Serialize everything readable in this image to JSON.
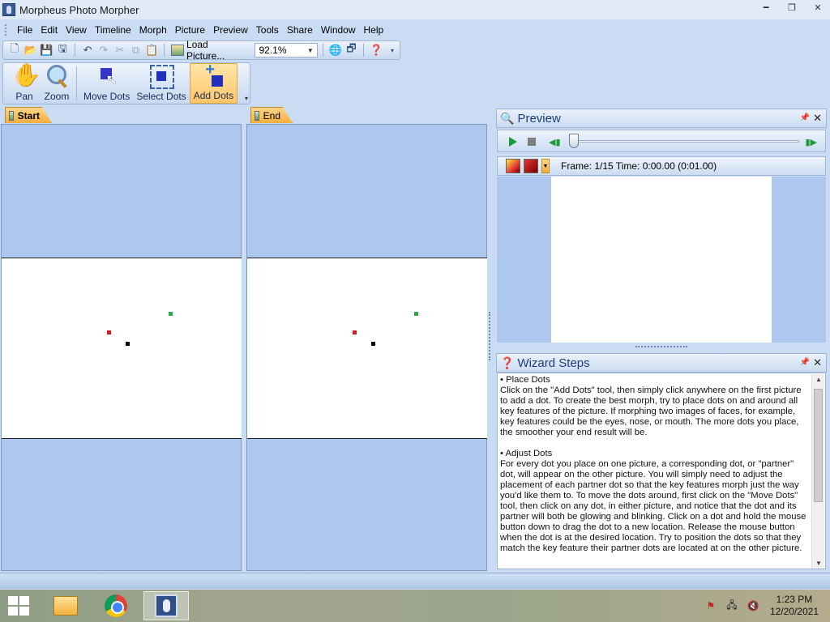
{
  "window": {
    "title": "Morpheus Photo Morpher"
  },
  "menu": [
    "File",
    "Edit",
    "View",
    "Timeline",
    "Morph",
    "Picture",
    "Preview",
    "Tools",
    "Share",
    "Window",
    "Help"
  ],
  "quickbar": {
    "load_label": "Load Picture...",
    "zoom_value": "92.1%"
  },
  "tools": {
    "pan": "Pan",
    "zoom": "Zoom",
    "move_dots": "Move Dots",
    "select_dots": "Select Dots",
    "add_dots": "Add Dots",
    "active": "add_dots"
  },
  "tabs": {
    "start": "Start",
    "end": "End"
  },
  "dots": {
    "colors": {
      "green": "#2fa84f",
      "red": "#d11c1c",
      "black": "#000000"
    }
  },
  "preview": {
    "title": "Preview",
    "frame_info": "Frame: 1/15 Time: 0:00.00 (0:01.00)",
    "slider_position": 0
  },
  "wizard": {
    "title": "Wizard Steps",
    "sections": [
      {
        "heading": "• Place Dots",
        "body": "Click on the \"Add Dots\" tool, then simply click anywhere on the first picture to add a dot.  To create the best morph, try to place dots on and around all key features of the picture.  If morphing two images of faces, for example, key features could be the eyes, nose, or mouth.  The more dots you place, the smoother your end result will be."
      },
      {
        "heading": "• Adjust Dots",
        "body": "For every dot you place on one picture, a corresponding dot, or \"partner\" dot, will appear on the other picture.  You will simply need to adjust the placement of each partner dot so that the key features morph just the way you'd like them to.  To move the dots around, first click on the \"Move Dots\" tool, then click on any dot, in either picture, and notice that the dot and its partner will both be glowing and blinking.  Click on a dot and hold the mouse button down to drag the dot to a new location.  Release the mouse button when the dot is at the desired location.  Try to position the dots so that they match the key feature their partner dots are located at on the other picture."
      }
    ]
  },
  "taskbar": {
    "time": "1:23 PM",
    "date": "12/20/2021"
  }
}
